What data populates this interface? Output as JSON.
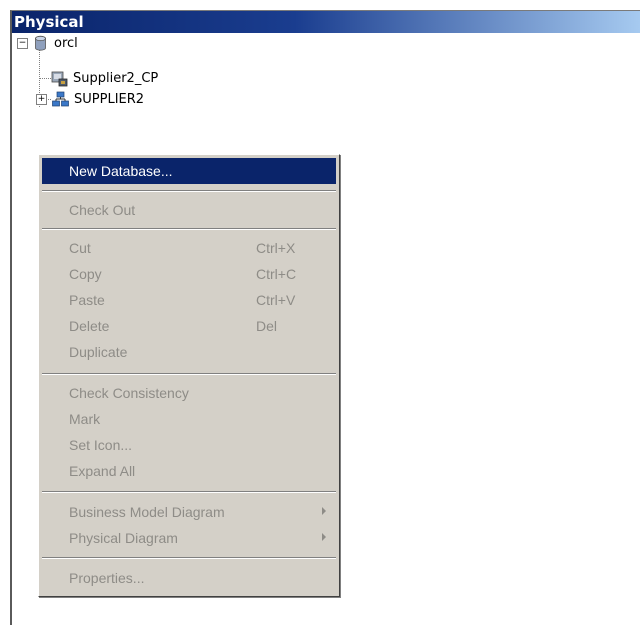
{
  "panel": {
    "title": "Physical"
  },
  "tree": {
    "root": {
      "label": "orcl",
      "expander": "−"
    },
    "children": [
      {
        "label": "Supplier2_CP",
        "icon": "connection-pool-icon"
      },
      {
        "label": "SUPPLIER2",
        "icon": "schema-icon",
        "expander": "+"
      }
    ]
  },
  "context_menu": {
    "items": [
      {
        "label": "New Database...",
        "enabled": true,
        "highlighted": true
      },
      {
        "label": "Check Out",
        "enabled": false
      },
      {
        "label": "Cut",
        "shortcut": "Ctrl+X",
        "enabled": false
      },
      {
        "label": "Copy",
        "shortcut": "Ctrl+C",
        "enabled": false
      },
      {
        "label": "Paste",
        "shortcut": "Ctrl+V",
        "enabled": false
      },
      {
        "label": "Delete",
        "shortcut": "Del",
        "enabled": false
      },
      {
        "label": "Duplicate",
        "enabled": false
      },
      {
        "label": "Check Consistency",
        "enabled": false
      },
      {
        "label": "Mark",
        "enabled": false
      },
      {
        "label": "Set Icon...",
        "enabled": false
      },
      {
        "label": "Expand All",
        "enabled": false
      },
      {
        "label": "Business Model Diagram",
        "enabled": false,
        "submenu": true
      },
      {
        "label": "Physical Diagram",
        "enabled": false,
        "submenu": true
      },
      {
        "label": "Properties...",
        "enabled": false
      }
    ]
  },
  "colors": {
    "highlight": "#0a246a",
    "menu_bg": "#d4d0c8",
    "disabled_text": "#8e8c87"
  }
}
